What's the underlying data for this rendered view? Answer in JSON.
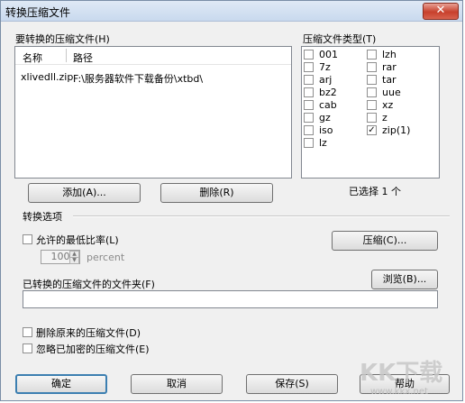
{
  "window": {
    "title": "转换压缩文件",
    "close_glyph": "✕"
  },
  "files": {
    "label": "要转换的压缩文件(H)",
    "columns": [
      "名称",
      "路径"
    ],
    "rows": [
      {
        "name": "xlivedll.zip",
        "path": "F:\\服务器软件下载备份\\xtbd\\"
      }
    ]
  },
  "types": {
    "label": "压缩文件类型(T)",
    "left": [
      {
        "name": "001",
        "checked": false
      },
      {
        "name": "7z",
        "checked": false
      },
      {
        "name": "arj",
        "checked": false
      },
      {
        "name": "bz2",
        "checked": false
      },
      {
        "name": "cab",
        "checked": false
      },
      {
        "name": "gz",
        "checked": false
      },
      {
        "name": "iso",
        "checked": false
      },
      {
        "name": "lz",
        "checked": false
      }
    ],
    "right": [
      {
        "name": "lzh",
        "checked": false
      },
      {
        "name": "rar",
        "checked": false
      },
      {
        "name": "tar",
        "checked": false
      },
      {
        "name": "uue",
        "checked": false
      },
      {
        "name": "xz",
        "checked": false
      },
      {
        "name": "z",
        "checked": false
      },
      {
        "name": "zip(1)",
        "checked": true
      }
    ],
    "selected_text": "已选择 1 个"
  },
  "buttons": {
    "add": "添加(A)...",
    "delete": "删除(R)",
    "compress": "压缩(C)...",
    "browse": "浏览(B)...",
    "ok": "确定",
    "cancel": "取消",
    "save": "保存(S)",
    "help": "帮助"
  },
  "options": {
    "group_label": "转换选项",
    "min_ratio_label": "允许的最低比率(L)",
    "min_ratio_value": "100",
    "percent_label": "percent",
    "folder_label": "已转换的压缩文件的文件夹(F)",
    "folder_value": "",
    "delete_original_label": "删除原来的压缩文件(D)",
    "ignore_encrypted_label": "忽略已加密的压缩文件(E)"
  },
  "icons": {
    "check": "✓",
    "spin_up": "▲",
    "spin_down": "▼"
  },
  "watermark": {
    "main": "KK下载",
    "sub": "www.kkx.net"
  }
}
